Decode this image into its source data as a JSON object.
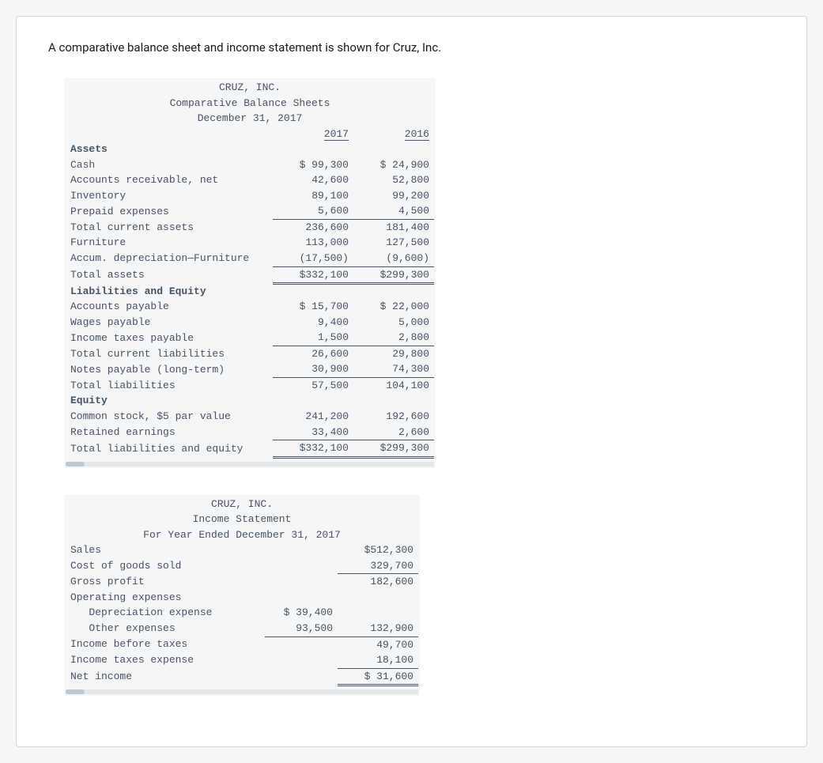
{
  "intro": "A comparative balance sheet and income statement is shown for Cruz, Inc.",
  "bs": {
    "company": "CRUZ, INC.",
    "title": "Comparative Balance Sheets",
    "date": "December 31, 2017",
    "col1": "2017",
    "col2": "2016",
    "assets_h": "Assets",
    "cash_l": "Cash",
    "cash_1": "$ 99,300",
    "cash_2": "$ 24,900",
    "ar_l": "Accounts receivable, net",
    "ar_1": "42,600",
    "ar_2": "52,800",
    "inv_l": "Inventory",
    "inv_1": "89,100",
    "inv_2": "99,200",
    "pre_l": "Prepaid expenses",
    "pre_1": "5,600",
    "pre_2": "4,500",
    "tca_l": "Total current assets",
    "tca_1": "236,600",
    "tca_2": "181,400",
    "fur_l": "Furniture",
    "fur_1": "113,000",
    "fur_2": "127,500",
    "ad_l": "Accum. depreciation—Furniture",
    "ad_1": "(17,500)",
    "ad_2": "(9,600)",
    "ta_l": "Total assets",
    "ta_1": "$332,100",
    "ta_2": "$299,300",
    "le_h": "Liabilities and Equity",
    "ap_l": "Accounts payable",
    "ap_1": "$ 15,700",
    "ap_2": "$ 22,000",
    "wp_l": "Wages payable",
    "wp_1": "9,400",
    "wp_2": "5,000",
    "it_l": "Income taxes payable",
    "it_1": "1,500",
    "it_2": "2,800",
    "tcl_l": "Total current liabilities",
    "tcl_1": "26,600",
    "tcl_2": "29,800",
    "np_l": "Notes payable (long-term)",
    "np_1": "30,900",
    "np_2": "74,300",
    "tl_l": "Total liabilities",
    "tl_1": "57,500",
    "tl_2": "104,100",
    "eq_h": "Equity",
    "cs_l": "Common stock, $5 par value",
    "cs_1": "241,200",
    "cs_2": "192,600",
    "re_l": "Retained earnings",
    "re_1": "33,400",
    "re_2": "2,600",
    "tle_l": "Total liabilities and equity",
    "tle_1": "$332,100",
    "tle_2": "$299,300"
  },
  "is": {
    "company": "CRUZ, INC.",
    "title": "Income Statement",
    "date": "For Year Ended December 31, 2017",
    "sales_l": "Sales",
    "sales_v": "$512,300",
    "cogs_l": "Cost of goods sold",
    "cogs_v": "329,700",
    "gp_l": "Gross profit",
    "gp_v": "182,600",
    "oe_h": "Operating expenses",
    "dep_l": "   Depreciation expense",
    "dep_v": "$ 39,400",
    "oth_l": "   Other expenses",
    "oth_v": "93,500",
    "oth_t": "132,900",
    "ibt_l": "Income before taxes",
    "ibt_v": "49,700",
    "ite_l": "Income taxes expense",
    "ite_v": "18,100",
    "ni_l": "Net income",
    "ni_v": "$ 31,600"
  }
}
